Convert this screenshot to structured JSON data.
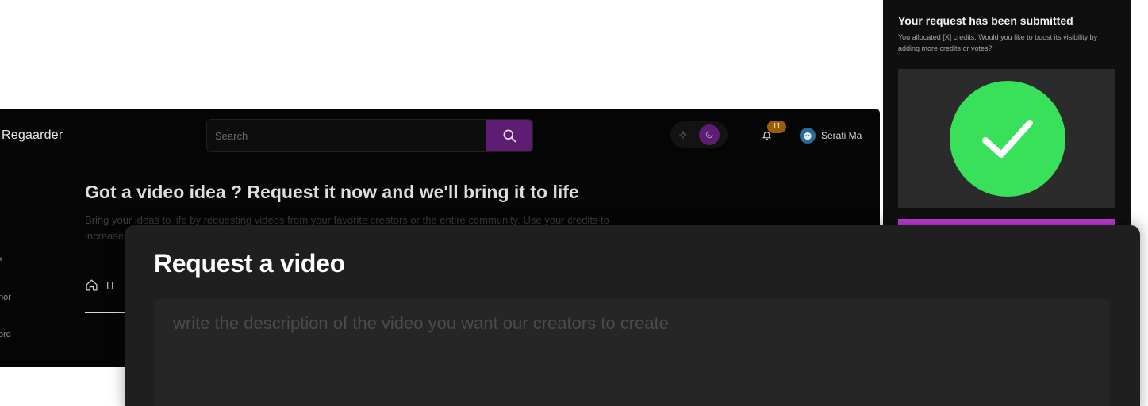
{
  "header": {
    "brand": "Regaarder",
    "search_placeholder": "Search",
    "notification_count": "11",
    "user_name": "Serati Ma"
  },
  "sidebar": {
    "items": [
      {
        "label": "s"
      },
      {
        "label": "nor"
      },
      {
        "label": "ord"
      }
    ]
  },
  "hero": {
    "title": "Got a video idea ? Request it now and we'll bring it to life",
    "subtitle": "Bring your ideas to life by requesting videos from your favorite creators or the entire community. Use your credits to increase"
  },
  "tabs": [
    {
      "label": "H"
    }
  ],
  "success_panel": {
    "title": "Your request has been submitted",
    "description": "You allocated [X] credits. Would you like to boost its visibility by adding more credits or votes?",
    "accent_color": "#c63bdf",
    "check_color": "#39e05a"
  },
  "request_modal": {
    "title": "Request a video",
    "description_placeholder": "write the description of the video you want our creators to create"
  },
  "colors": {
    "brand_purple": "#5c1d73",
    "badge_orange": "#9c5d06"
  },
  "icons": {
    "search": "search-icon",
    "sun": "sun-icon",
    "moon": "moon-icon",
    "bell": "bell-icon",
    "home": "home-icon",
    "check": "checkmark-icon"
  }
}
